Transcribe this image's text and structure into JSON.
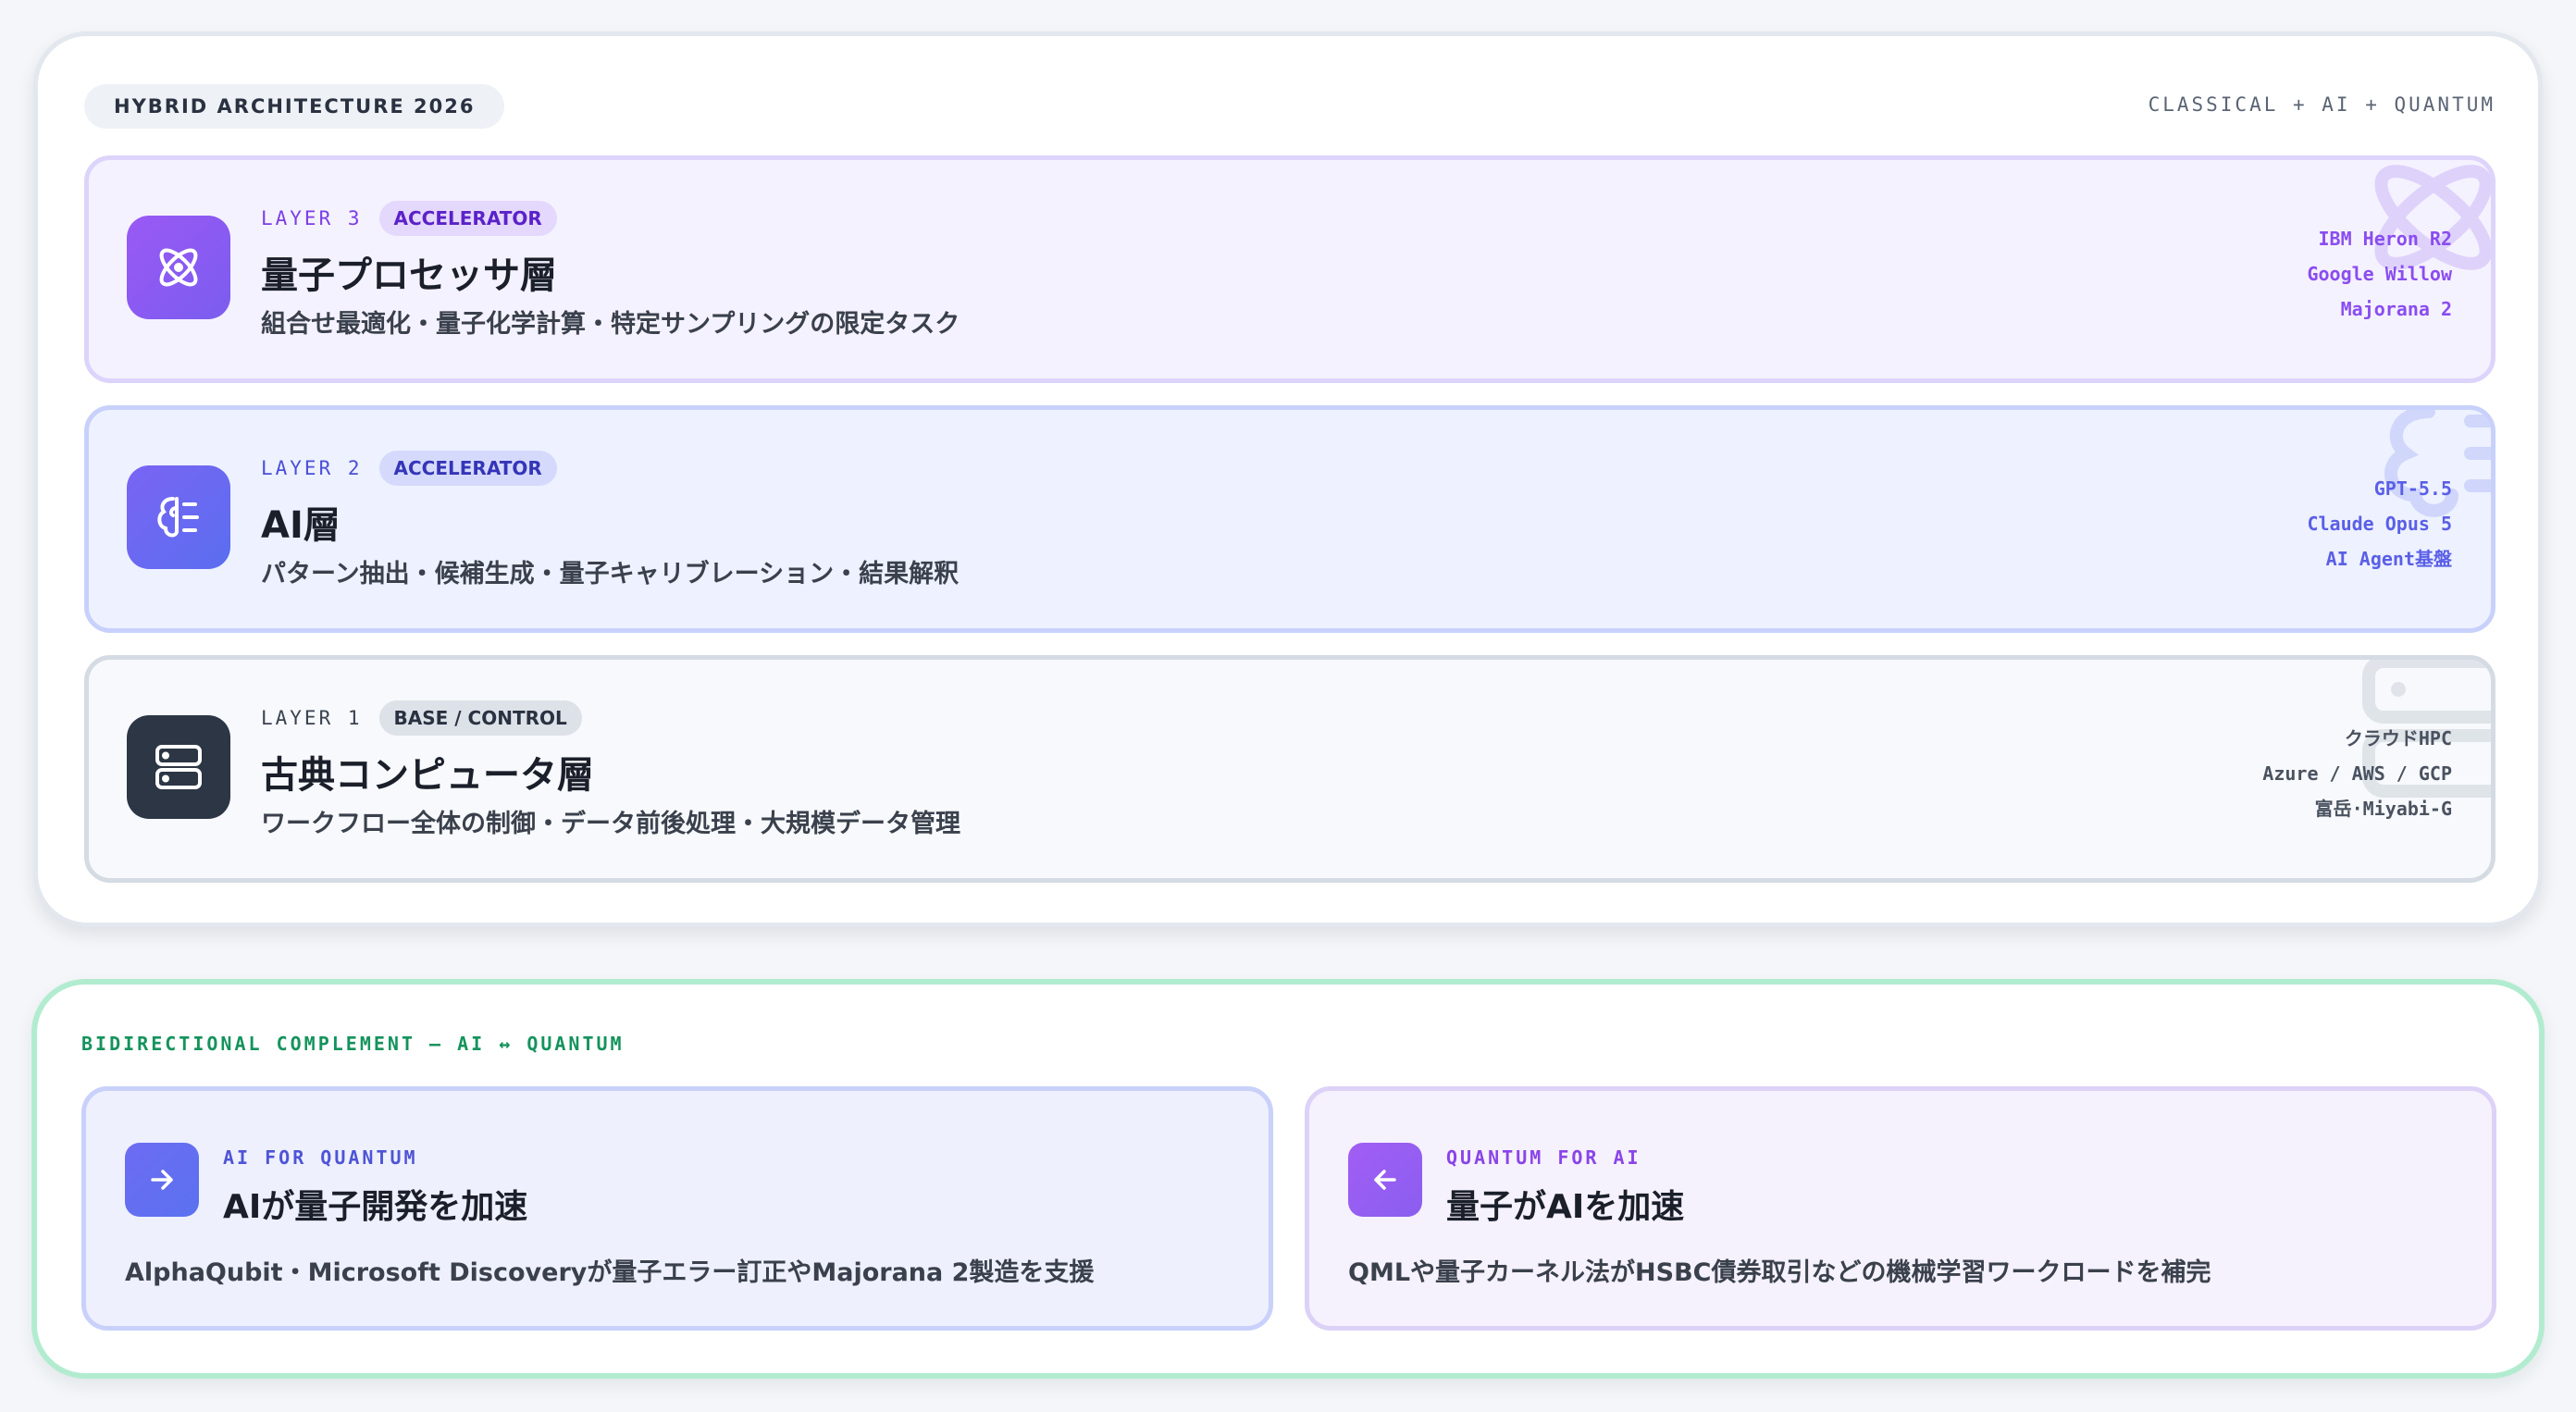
{
  "header": {
    "pill_label": "HYBRID ARCHITECTURE 2026",
    "right_label": "CLASSICAL + AI + QUANTUM"
  },
  "layers": [
    {
      "num": "LAYER 3",
      "badge": "ACCELERATOR",
      "title": "量子プロセッサ層",
      "desc": "組合せ最適化・量子化学計算・特定サンプリングの限定タスク",
      "items": [
        "IBM Heron R2",
        "Google Willow",
        "Majorana 2"
      ],
      "icon": "atom-icon"
    },
    {
      "num": "LAYER 2",
      "badge": "ACCELERATOR",
      "title": "AI層",
      "desc": "パターン抽出・候補生成・量子キャリブレーション・結果解釈",
      "items": [
        "GPT-5.5",
        "Claude Opus 5",
        "AI Agent基盤"
      ],
      "icon": "brain-icon"
    },
    {
      "num": "LAYER 1",
      "badge": "BASE / CONTROL",
      "title": "古典コンピュータ層",
      "desc": "ワークフロー全体の制御・データ前後処理・大規模データ管理",
      "items": [
        "クラウドHPC",
        "Azure / AWS / GCP",
        "富岳·Miyabi-G"
      ],
      "icon": "server-icon"
    }
  ],
  "complement": {
    "label": "BIDIRECTIONAL COMPLEMENT — AI ↔ QUANTUM",
    "cards": [
      {
        "tag": "AI FOR QUANTUM",
        "title": "AIが量子開発を加速",
        "desc": "AlphaQubit・Microsoft Discoveryが量子エラー訂正やMajorana 2製造を支援",
        "icon": "arrow-right-icon"
      },
      {
        "tag": "QUANTUM FOR AI",
        "title": "量子がAIを加速",
        "desc": "QMLや量子カーネル法がHSBC債券取引などの機械学習ワークロードを補完",
        "icon": "arrow-left-icon"
      }
    ]
  },
  "colors": {
    "layer3_accent": "#8a4df0",
    "layer2_accent": "#5a5fe6",
    "layer1_accent": "#2c3644",
    "complement_accent": "#14935c"
  }
}
